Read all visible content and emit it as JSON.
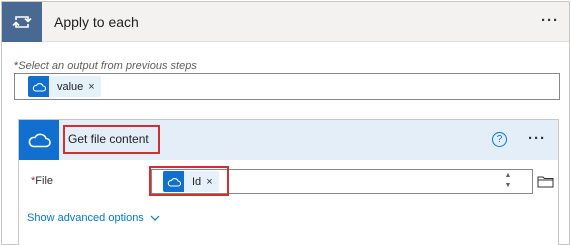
{
  "apply_to_each": {
    "title": "Apply to each",
    "more_label": "···",
    "select_label": "Select an output from previous steps",
    "required_marker": "*",
    "token": {
      "label": "value",
      "remove": "×",
      "icon": "onedrive-cloud-icon"
    }
  },
  "get_file_content": {
    "title": "Get file content",
    "help_label": "?",
    "more_label": "···",
    "file_label": "File",
    "required_marker": "*",
    "file_token": {
      "label": "Id",
      "remove": "×",
      "icon": "onedrive-cloud-icon"
    },
    "spinner_up": "▲",
    "spinner_down": "▼",
    "advanced_label": "Show advanced options"
  },
  "colors": {
    "loop_header": "#486991",
    "onedrive_blue": "#1170cf",
    "highlight_red": "#d32f2f",
    "link_blue": "#0078d4"
  }
}
